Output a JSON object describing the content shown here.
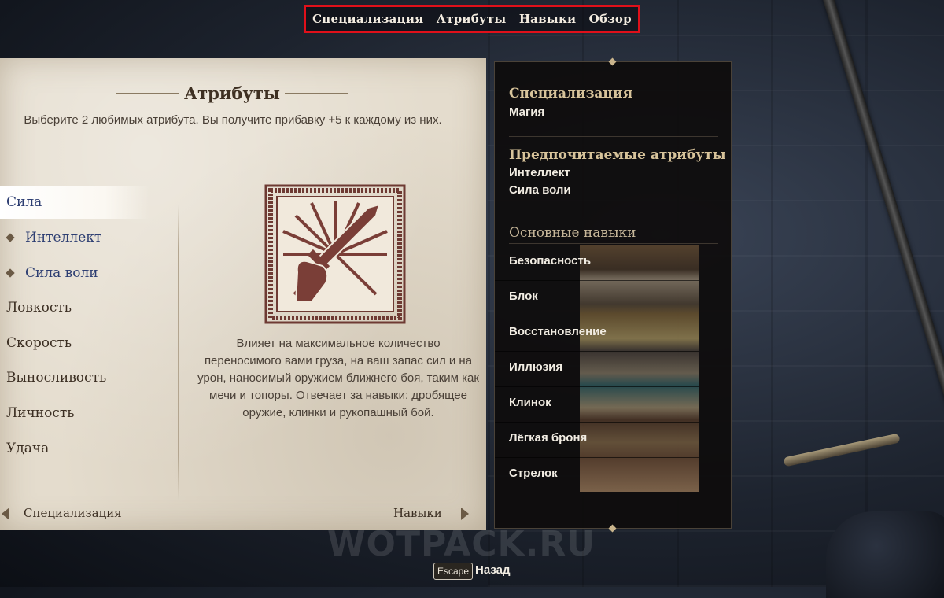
{
  "top_nav": {
    "tabs": [
      "Специализация",
      "Атрибуты",
      "Навыки",
      "Обзор"
    ]
  },
  "attributes_panel": {
    "title": "Атрибуты",
    "subtitle": "Выберите 2 любимых атрибута. Вы получите прибавку +5 к каждому из них.",
    "items": [
      {
        "label": "Сила",
        "state": "selected"
      },
      {
        "label": "Интеллект",
        "state": "preferred"
      },
      {
        "label": "Сила воли",
        "state": "preferred"
      },
      {
        "label": "Ловкость",
        "state": "normal"
      },
      {
        "label": "Скорость",
        "state": "normal"
      },
      {
        "label": "Выносливость",
        "state": "normal"
      },
      {
        "label": "Личность",
        "state": "normal"
      },
      {
        "label": "Удача",
        "state": "normal"
      }
    ],
    "emblem_icon": "fist-sword-icon",
    "description": "Влияет на максимальное количество переносимого вами груза, на ваш запас сил и на урон, наносимый оружием ближнего боя, таким как мечи и топоры. Отвечает за навыки: дробящее оружие, клинки и рукопашный бой.",
    "prev_label": "Специализация",
    "next_label": "Навыки"
  },
  "summary_panel": {
    "specialization_heading": "Специализация",
    "specialization_value": "Магия",
    "preferred_heading": "Предпочитаемые атрибуты",
    "preferred_values": [
      "Интеллект",
      "Сила воли"
    ],
    "skills_heading": "Основные навыки",
    "skills": [
      "Безопасность",
      "Блок",
      "Восстановление",
      "Иллюзия",
      "Клинок",
      "Лёгкая броня",
      "Стрелок"
    ]
  },
  "footer": {
    "watermark": "WOTPACK.RU",
    "escape_key": "Escape",
    "back_label": "Назад"
  },
  "colors": {
    "nav_highlight": "#e0101a",
    "parchment": "#e4dccd",
    "preferred_text": "#2d3e72",
    "summary_heading": "#d7c39a"
  }
}
